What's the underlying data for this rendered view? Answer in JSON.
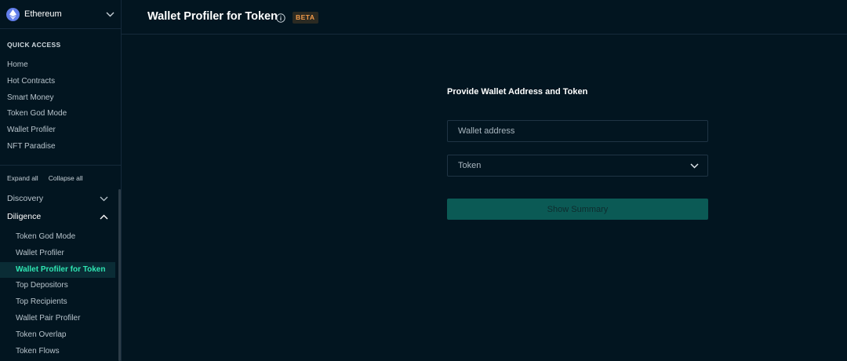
{
  "sidebar": {
    "chain": "Ethereum",
    "quick_access_title": "QUICK ACCESS",
    "quick_access": [
      "Home",
      "Hot Contracts",
      "Smart Money",
      "Token God Mode",
      "Wallet Profiler",
      "NFT Paradise"
    ],
    "expand_all": "Expand all",
    "collapse_all": "Collapse all",
    "groups": {
      "discovery": "Discovery",
      "diligence": "Diligence"
    },
    "diligence_items": [
      "Token God Mode",
      "Wallet Profiler",
      "Wallet Profiler for Token",
      "Top Depositors",
      "Top Recipients",
      "Wallet Pair Profiler",
      "Token Overlap",
      "Token Flows"
    ],
    "active_item": "Wallet Profiler for Token"
  },
  "header": {
    "title": "Wallet Profiler for Token",
    "badge": "BETA"
  },
  "form": {
    "heading": "Provide Wallet Address and Token",
    "wallet_placeholder": "Wallet address",
    "token_placeholder": "Token",
    "submit_label": "Show Summary"
  },
  "colors": {
    "background": "#021520",
    "accent": "#2ee6b3",
    "button": "#0b5a55",
    "badge_text": "#f39b4a",
    "ethereum": "#627eea"
  }
}
